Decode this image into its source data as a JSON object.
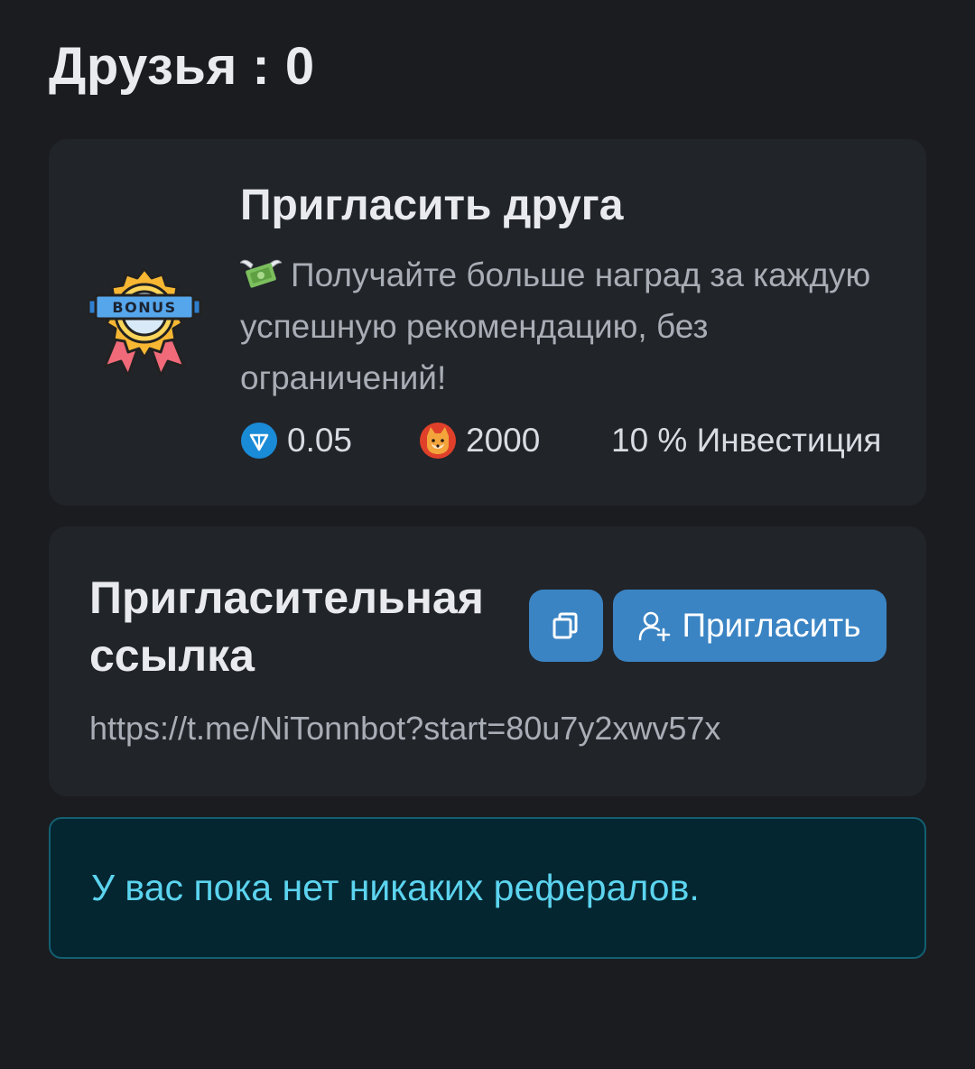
{
  "header": {
    "title": "Друзья : 0"
  },
  "invite_card": {
    "badge_icon": "bonus-badge-icon",
    "badge_text": "BONUS",
    "title": "Пригласить друга",
    "description_icon": "money-with-wings-icon",
    "description": "Получайте больше наград за каждую успешную рекомендацию, без ограничений!",
    "rewards": [
      {
        "icon": "ton-coin-icon",
        "value": "0.05"
      },
      {
        "icon": "shiba-coin-icon",
        "value": "2000"
      },
      {
        "value": "10 % Инвестиция"
      }
    ]
  },
  "link_card": {
    "title": "Пригласительная ссылка",
    "copy_icon": "copy-icon",
    "invite_button_icon": "user-plus-icon",
    "invite_button_label": "Пригласить",
    "link": "https://t.me/NiTonnbot?start=80u7y2xwv57x"
  },
  "referrals_alert": {
    "message": "У вас пока нет никаких рефералов."
  },
  "colors": {
    "background": "#1a1c20",
    "card": "#212429",
    "accent": "#3a84c4",
    "alert_bg": "#042630",
    "alert_border": "#136072",
    "alert_text": "#5cd4ef"
  }
}
